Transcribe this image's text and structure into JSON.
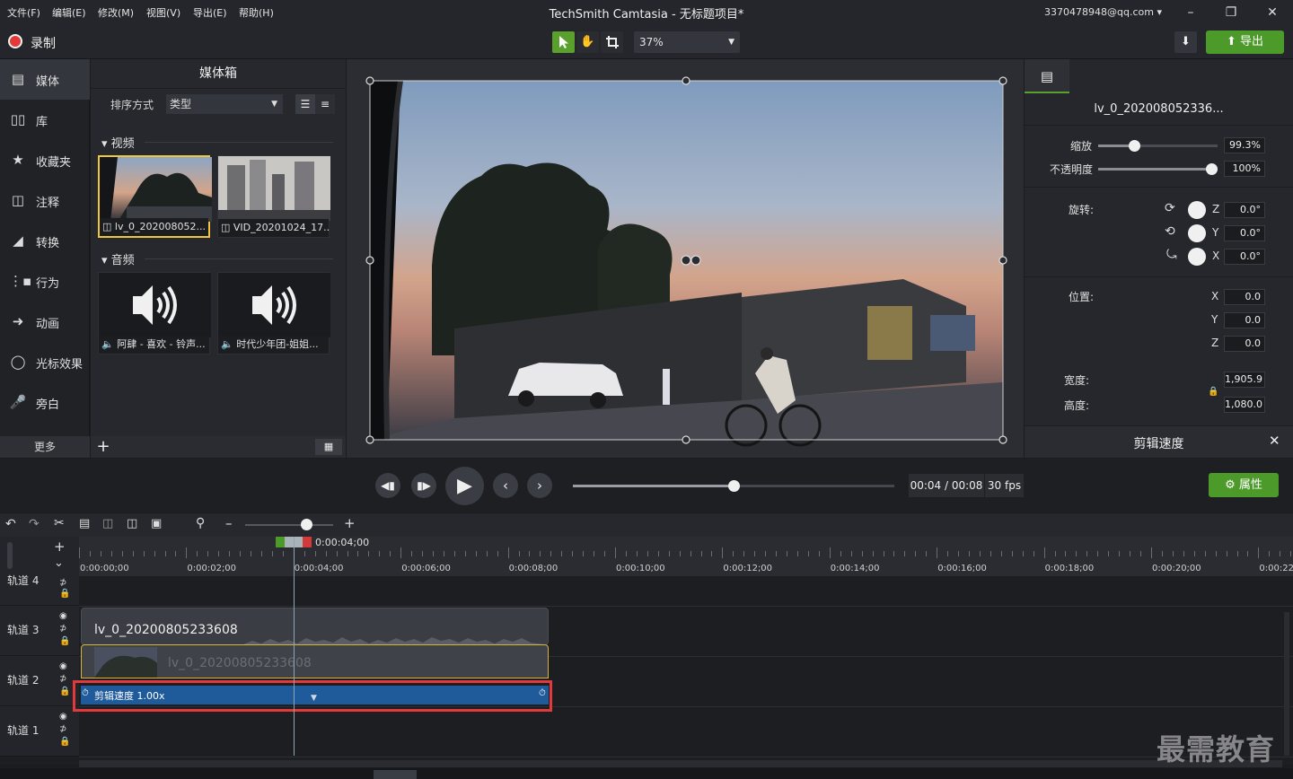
{
  "titlebar": {
    "menus": [
      "文件(F)",
      "编辑(E)",
      "修改(M)",
      "视图(V)",
      "导出(E)",
      "帮助(H)"
    ],
    "title": "TechSmith Camtasia - 无标题项目*",
    "account": "3370478948@qq.com ▾"
  },
  "toolbar": {
    "record_label": "录制",
    "zoom": "37%",
    "export_label": "导出"
  },
  "nav": {
    "items": [
      "媒体",
      "库",
      "收藏夹",
      "注释",
      "转换",
      "行为",
      "动画",
      "光标效果",
      "旁白"
    ],
    "more": "更多"
  },
  "bin": {
    "title": "媒体箱",
    "sort_label": "排序方式",
    "sort_value": "类型",
    "video_section": "视频",
    "audio_section": "音频",
    "videos": [
      "lv_0_202008052...",
      "VID_20201024_17..."
    ],
    "audios": [
      "阿肆 - 喜欢 - 铃声...",
      "时代少年团-姐姐..."
    ]
  },
  "props": {
    "clip_name": "lv_0_202008052336...",
    "scale_label": "缩放",
    "scale_value": "99.3%",
    "scale_level": 0.3,
    "opacity_label": "不透明度",
    "opacity_value": "100%",
    "opacity_level": 1.0,
    "rotation_label": "旋转:",
    "rot_z": "0.0°",
    "rot_y": "0.0°",
    "rot_x": "0.0°",
    "position_label": "位置:",
    "pos_x": "0.0",
    "pos_y": "0.0",
    "pos_z": "0.0",
    "width_label": "宽度:",
    "width_value": "1,905.9",
    "height_label": "高度:",
    "height_value": "1,080.0",
    "axis_x": "X",
    "axis_y": "Y",
    "axis_z": "Z",
    "clip_speed_label": "剪辑速度",
    "properties_button": "属性"
  },
  "playback": {
    "time": "00:04 / 00:08",
    "fps": "30 fps",
    "progress": 0.5
  },
  "timeline": {
    "playhead_time": "0:00:04;00",
    "ticks": [
      "0:00:00;00",
      "0:00:02;00",
      "0:00:04;00",
      "0:00:06;00",
      "0:00:08;00",
      "0:00:10;00",
      "0:00:12;00",
      "0:00:14;00",
      "0:00:16;00",
      "0:00:18;00",
      "0:00:20;00",
      "0:00:22"
    ],
    "tracks": [
      "轨道 4",
      "轨道 3",
      "轨道 2",
      "轨道 1"
    ],
    "track3_clip": "lv_0_2020080523360 8",
    "track3_clip_name": "lv_0_20200805233608",
    "track2_clip_name": "lv_0_20200805233608",
    "speed_label": "剪辑速度 1.00x"
  },
  "watermark": "最需教育"
}
